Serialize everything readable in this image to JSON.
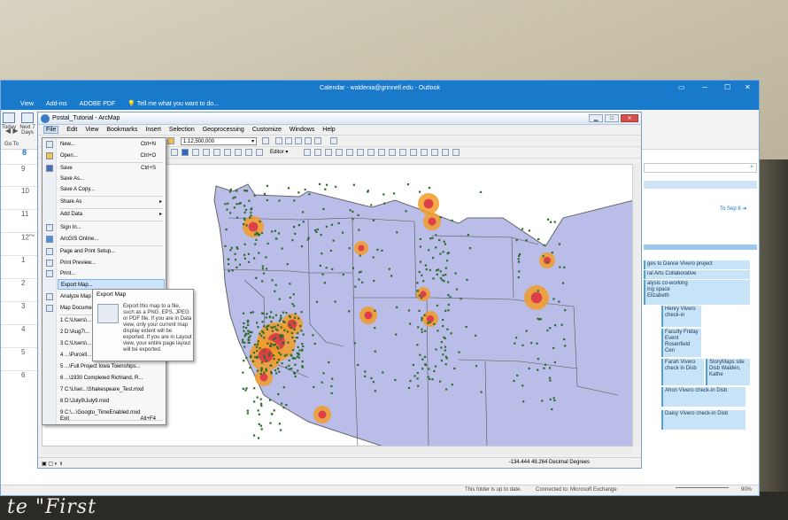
{
  "background": {
    "caption": "te \"First"
  },
  "outlook": {
    "title": "Calendar - waldenia@grinnell.edu - Outlook",
    "menu": [
      "View",
      "Add-ins",
      "ADOBE PDF"
    ],
    "tell_me": "Tell me what you want to do...",
    "ribbon": {
      "today_label": "Today",
      "next7_label": "Next 7 Days",
      "goto_label": "Go To"
    },
    "date_label": "8",
    "hours": [
      "9",
      "10",
      "11",
      "12",
      "1",
      "2",
      "3",
      "4",
      "5",
      "6"
    ],
    "pm_mark": "PM",
    "to_date": "To Sep 8",
    "appointments": [
      "ges to Dance Vivero project",
      "ral Arts Collaborative",
      "alysis co-working",
      "ing space",
      "Elizabeth",
      "Henry Vivero check-in",
      "Faculty Friday Event Rosenfield Cen",
      "Farah Vivero check in Disb",
      "StoryMaps site Disb Walden, Kathe",
      "Ahon Vivero check-in Disb",
      "Daisy Vivero check-in Disb"
    ],
    "status_left": "This folder is up to date.",
    "status_conn": "Connected to: Microsoft Exchange",
    "zoom": "90%"
  },
  "arcmap": {
    "title": "Postal_Tutorial - ArcMap",
    "menu": [
      "File",
      "Edit",
      "View",
      "Bookmarks",
      "Insert",
      "Selection",
      "Geoprocessing",
      "Customize",
      "Windows",
      "Help"
    ],
    "scale": "1:12,500,000",
    "editor_label": "Editor",
    "coordinates": "-134.444  49.264 Decimal Degrees",
    "colors": {
      "map_fill": "#b9bde8",
      "point": "#2e6b2e",
      "hotspot": "#f29c28",
      "hotspot_core": "#d8284a"
    }
  },
  "file_menu": {
    "items": [
      {
        "label": "New...",
        "shortcut": "Ctrl+N"
      },
      {
        "label": "Open...",
        "shortcut": "Ctrl+O"
      },
      {
        "label": "Save",
        "shortcut": "Ctrl+S"
      },
      {
        "label": "Save As...",
        "shortcut": ""
      },
      {
        "label": "Save A Copy...",
        "shortcut": ""
      },
      {
        "label": "Share As",
        "shortcut": ""
      },
      {
        "label": "Add Data",
        "shortcut": ""
      },
      {
        "label": "Sign In...",
        "shortcut": ""
      },
      {
        "label": "ArcGIS Online...",
        "shortcut": ""
      },
      {
        "label": "Page and Print Setup...",
        "shortcut": ""
      },
      {
        "label": "Print Preview...",
        "shortcut": ""
      },
      {
        "label": "Print...",
        "shortcut": ""
      },
      {
        "label": "Export Map...",
        "shortcut": ""
      },
      {
        "label": "Analyze Map",
        "shortcut": ""
      },
      {
        "label": "Map Document",
        "shortcut": ""
      },
      {
        "label": "1 C:\\Users\\...",
        "shortcut": ""
      },
      {
        "label": "2 D:\\Aug7\\...",
        "shortcut": ""
      },
      {
        "label": "3 C:\\Users\\...",
        "shortcut": ""
      },
      {
        "label": "4 ...\\Purcell...",
        "shortcut": ""
      },
      {
        "label": "5 ...\\Full Project Iowa Townships...",
        "shortcut": ""
      },
      {
        "label": "6 ...\\1930 Completed Richland, R...",
        "shortcut": ""
      },
      {
        "label": "7 C:\\User...\\Shakespeare_Test.mxd",
        "shortcut": ""
      },
      {
        "label": "8 D:\\July9\\July9.mxd",
        "shortcut": ""
      },
      {
        "label": "9 C:\\...\\Googtu_TimeEnabled.mxd",
        "shortcut": ""
      },
      {
        "label": "Exit",
        "shortcut": "Alt+F4"
      }
    ]
  },
  "tooltip": {
    "title": "Export Map",
    "text": "Export this map to a file, such as a PNG, EPS, JPEG or PDF file. If you are in Data view, only your current map display extent will be exported. If you are in Layout view, your entire page layout will be exported."
  }
}
